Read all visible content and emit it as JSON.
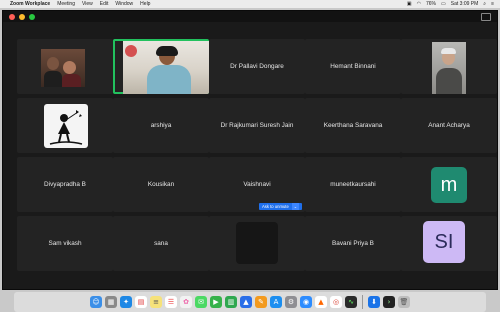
{
  "menubar": {
    "apple": "",
    "items": [
      "Zoom Workplace",
      "Meeting",
      "View",
      "Edit",
      "Window",
      "Help"
    ],
    "battery": "76%",
    "clock": "Sat 3:09 PM"
  },
  "participants": [
    {
      "name": "",
      "type": "video-couple"
    },
    {
      "name": "",
      "type": "video-speaker"
    },
    {
      "name": "Dr Pallavi Dongare",
      "type": "name"
    },
    {
      "name": "Hemant Binnani",
      "type": "name"
    },
    {
      "name": "",
      "type": "video-man"
    },
    {
      "name": "",
      "type": "avatar-image"
    },
    {
      "name": "arshiya",
      "type": "name"
    },
    {
      "name": "Dr Rajkumari Suresh Jain",
      "type": "name"
    },
    {
      "name": "Keerthana Saravana",
      "type": "name"
    },
    {
      "name": "Anant Acharya",
      "type": "name"
    },
    {
      "name": "Divyapradha B",
      "type": "name"
    },
    {
      "name": "Kousikan",
      "type": "name"
    },
    {
      "name": "Vaishnavi",
      "type": "name"
    },
    {
      "name": "muneetkaursahi",
      "type": "name"
    },
    {
      "name": "",
      "type": "avatar-letter",
      "letter": "m",
      "color": "#1f8a70"
    },
    {
      "name": "Sam vikash",
      "type": "name"
    },
    {
      "name": "sana",
      "type": "name"
    },
    {
      "name": "",
      "type": "blank"
    },
    {
      "name": "Bavani Priya B",
      "type": "name"
    },
    {
      "name": "",
      "type": "avatar-letter",
      "letter": "SI",
      "color": "#cdb9f5"
    }
  ],
  "ask_to_unmute": {
    "label": "Ask to unmute",
    "arrow": "⌄"
  },
  "dock": {
    "icons": [
      "finder-icon",
      "launchpad-icon",
      "safari-icon",
      "calendar-icon",
      "notes-icon",
      "reminders-icon",
      "photos-icon",
      "messages-icon",
      "facetime-icon",
      "numbers-icon",
      "keynote-icon",
      "pages-icon",
      "app-store-icon",
      "system-prefs-icon",
      "zoom-icon",
      "vlc-icon",
      "chrome-icon",
      "activity-monitor-icon",
      "terminal-icon",
      "trash-icon"
    ]
  }
}
